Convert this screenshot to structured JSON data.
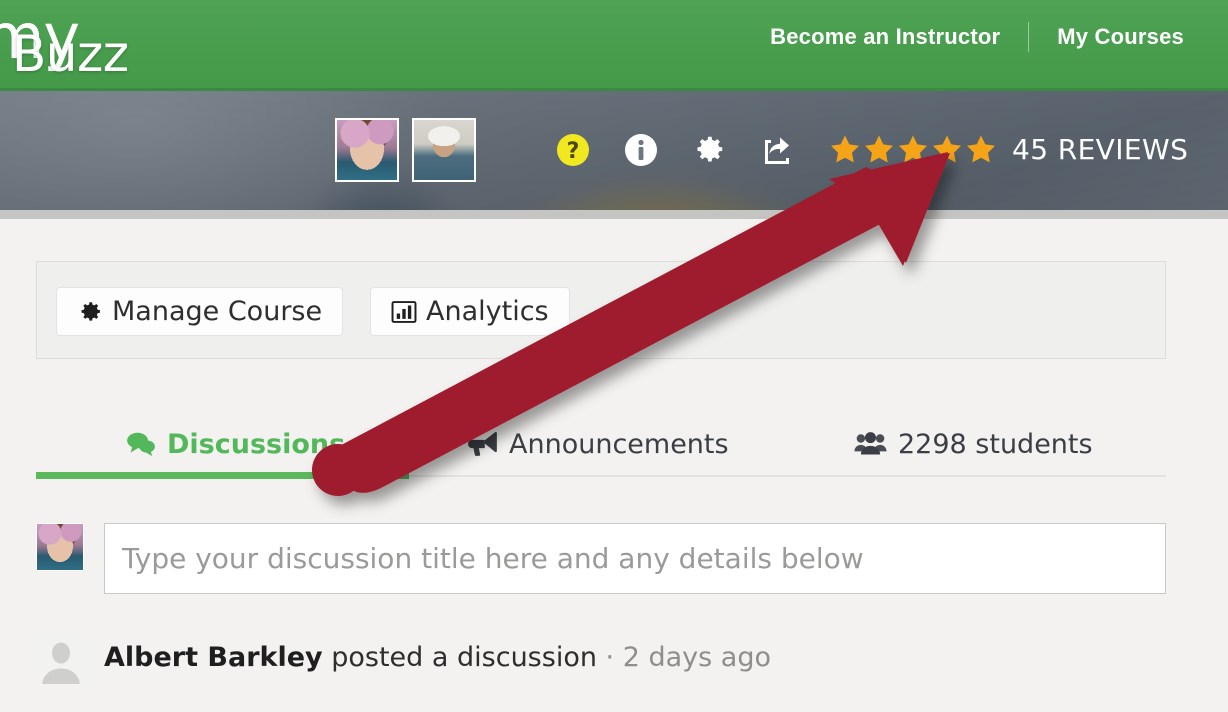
{
  "topnav": {
    "brand": "my",
    "links": [
      {
        "label": "Become an Instructor"
      },
      {
        "label": "My Courses"
      }
    ]
  },
  "banner": {
    "course_title": "Buzz",
    "instructors": [
      {
        "name": "instructor-avatar-1"
      },
      {
        "name": "instructor-avatar-2"
      }
    ],
    "icons": [
      {
        "name": "help-icon",
        "glyph": "?",
        "color": "#f2e820"
      },
      {
        "name": "info-icon",
        "glyph": "i",
        "color": "#ffffff"
      },
      {
        "name": "gear-icon",
        "glyph": "gear",
        "color": "#ffffff"
      },
      {
        "name": "share-icon",
        "glyph": "share",
        "color": "#ffffff"
      }
    ],
    "rating": {
      "stars_filled": 5,
      "stars_total": 5,
      "star_color": "#f6a417",
      "reviews_label": "45 REVIEWS"
    }
  },
  "toolbar": {
    "manage_label": "Manage Course",
    "analytics_label": "Analytics"
  },
  "tabs": {
    "active": "discussions",
    "active_color": "#53b75b",
    "items": [
      {
        "id": "discussions",
        "label": "Discussions",
        "icon": "comments-icon"
      },
      {
        "id": "announcements",
        "label": "Announcements",
        "icon": "megaphone-icon"
      },
      {
        "id": "students",
        "label": "2298 students",
        "icon": "users-icon"
      }
    ]
  },
  "composer": {
    "placeholder": "Type your discussion title here and any details below",
    "value": ""
  },
  "feed": {
    "items": [
      {
        "author": "Albert Barkley",
        "action": "posted a discussion",
        "separator": " · ",
        "time": "2 days ago"
      }
    ]
  },
  "annotation": {
    "arrow_color": "#9e1f2d",
    "points_to": "star-rating"
  }
}
